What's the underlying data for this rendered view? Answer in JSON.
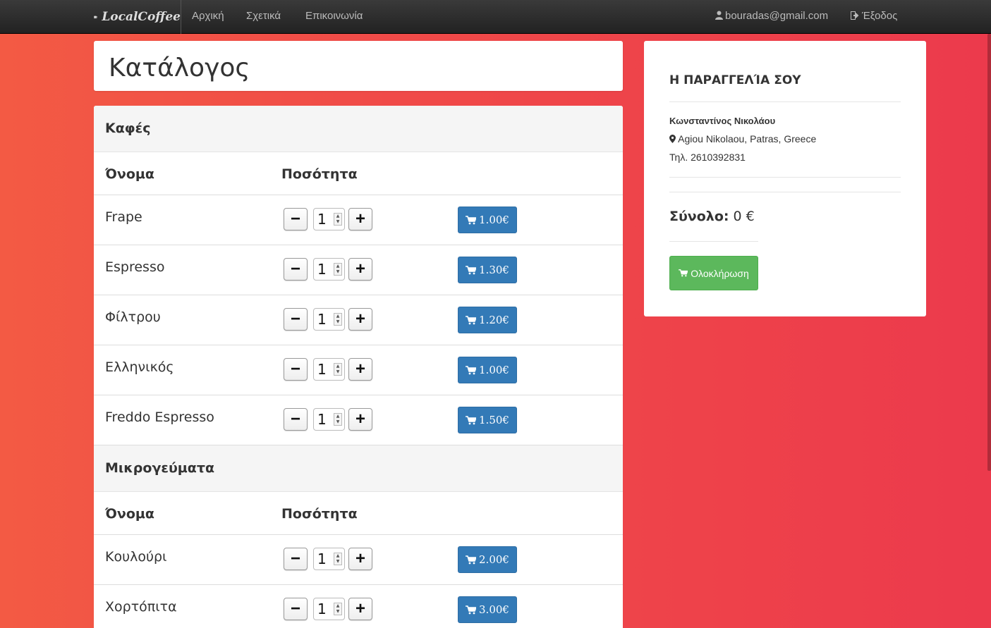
{
  "navbar": {
    "brand": "LocalCoffee",
    "links": [
      "Αρχική",
      "Σχετικά",
      "Επικοινωνία"
    ],
    "user_email": "bouradas@gmail.com",
    "logout": "Έξοδος"
  },
  "catalog": {
    "title": "Κατάλογος",
    "col_name": "Όνομα",
    "col_qty": "Ποσότητα",
    "categories": [
      {
        "name": "Καφές",
        "items": [
          {
            "name": "Frape",
            "qty": "1",
            "price": "1.00€"
          },
          {
            "name": "Espresso",
            "qty": "1",
            "price": "1.30€"
          },
          {
            "name": "Φίλτρου",
            "qty": "1",
            "price": "1.20€"
          },
          {
            "name": "Ελληνικός",
            "qty": "1",
            "price": "1.00€"
          },
          {
            "name": "Freddo Espresso",
            "qty": "1",
            "price": "1.50€"
          }
        ]
      },
      {
        "name": "Μικρογεύματα",
        "items": [
          {
            "name": "Κουλούρι",
            "qty": "1",
            "price": "2.00€"
          },
          {
            "name": "Χορτόπιτα",
            "qty": "1",
            "price": "3.00€"
          }
        ]
      }
    ]
  },
  "order": {
    "title": "Η ΠΑΡΑΓΓΕΛΊΑ ΣΟΥ",
    "customer_name": "Κωνσταντίνος Νικολάου",
    "address": "Agiou Nikolaou, Patras, Greece",
    "phone": "Τηλ. 2610392831",
    "total_label": "Σύνολο:",
    "total_value": "0 €",
    "complete_button": "Ολοκλήρωση"
  },
  "colors": {
    "primary_button": "#337ab7",
    "success_button": "#5cb85c",
    "background_gradient_start": "#f35a44",
    "background_gradient_end": "#ec3a4c"
  }
}
